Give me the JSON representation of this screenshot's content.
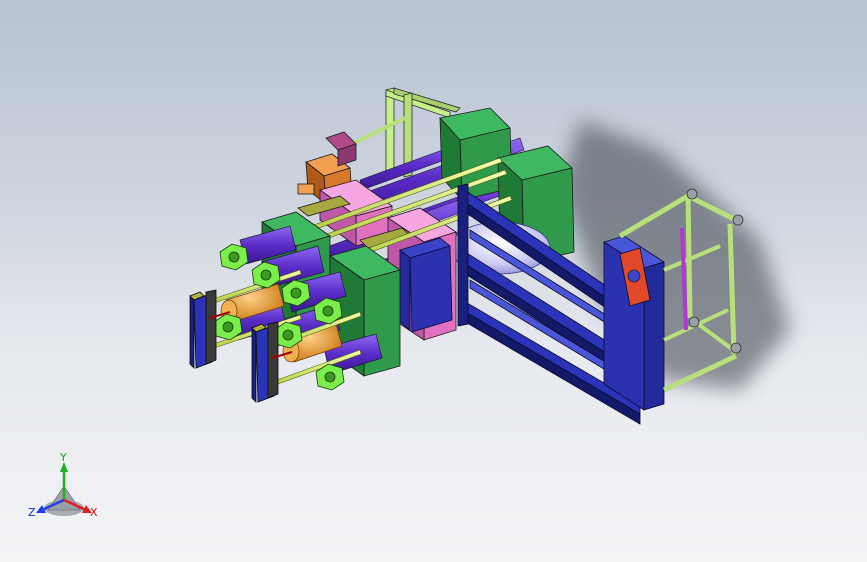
{
  "triad": {
    "x_label": "X",
    "y_label": "Y",
    "z_label": "Z",
    "x_color": "#e02020",
    "y_color": "#20b020",
    "z_color": "#2040e0"
  },
  "colors": {
    "background_top": "#b7c3d2",
    "background_bottom": "#f3f4f6",
    "frame": "#b8e07a",
    "plate_green": "#2e9a4a",
    "plate_pink": "#f08ad0",
    "plate_navy": "#232a9a",
    "rod_purple": "#6a3cd0",
    "rod_yellow": "#d8f06a",
    "nut_green": "#6adc3c",
    "cylinder_orange": "#e89a2a",
    "bracket_olive": "#8a8a2a"
  }
}
